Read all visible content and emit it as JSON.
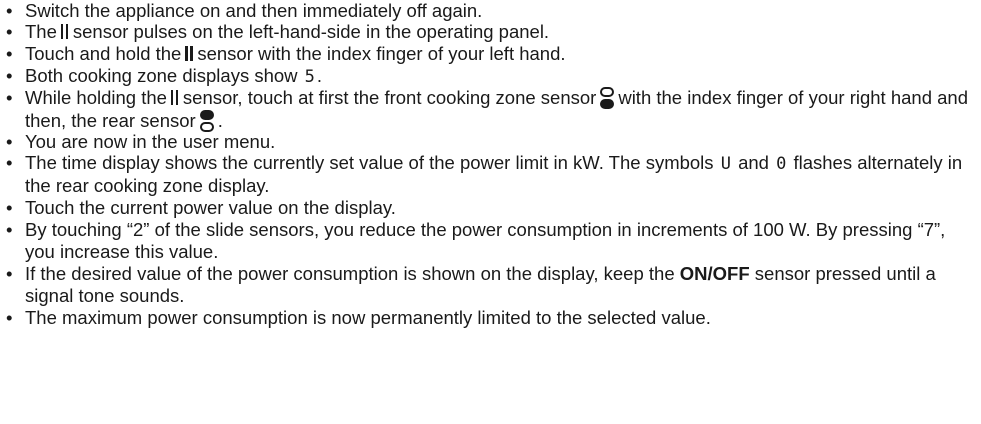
{
  "bullet": "•",
  "steps": [
    "Switch the appliance on and then immediately off again.",
    [
      "The",
      "sensor pulses on the left-hand-side in the operating panel."
    ],
    [
      "Touch and hold the",
      "sensor with the index finger of your left hand."
    ],
    [
      "Both cooking zone displays show",
      "5",
      "."
    ],
    [
      "While holding the",
      "sensor, touch at first the front cooking zone sensor",
      "with the index finger of your right hand and then, the rear sensor",
      "."
    ],
    "You are now in the user menu.",
    [
      "The time display shows the currently set value of the power limit in kW. The symbols",
      "U",
      "and",
      "0",
      "flashes alternately in the rear cooking zone display."
    ],
    "Touch the current power value on the display.",
    "By touching “2” of the slide sensors, you reduce the power consumption in increments of 100 W. By pressing “7”, you increase this value.",
    [
      "If the desired value of the power consumption is shown on the display, keep the",
      "ON/OFF",
      "sensor pressed until a signal tone sounds."
    ],
    "The maximum power consumption is now permanently limited to the selected value."
  ]
}
